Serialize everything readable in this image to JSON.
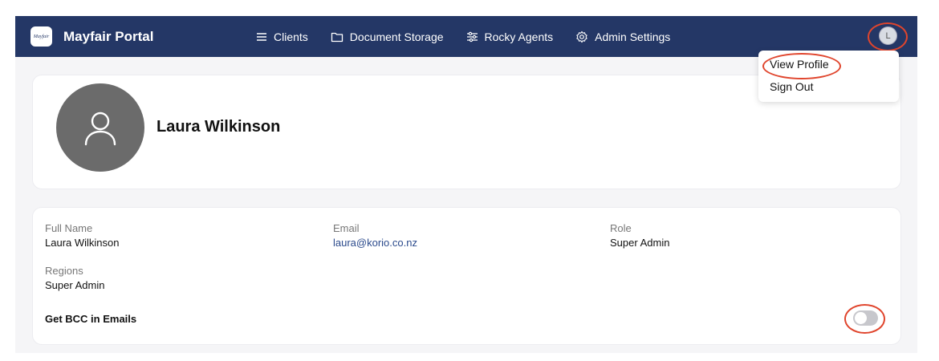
{
  "nav": {
    "brand_logo_text": "Mayfair",
    "brand_name": "Mayfair Portal",
    "items": [
      {
        "label": "Clients",
        "icon": "menu-icon"
      },
      {
        "label": "Document Storage",
        "icon": "folder-icon"
      },
      {
        "label": "Rocky Agents",
        "icon": "sliders-icon"
      },
      {
        "label": "Admin Settings",
        "icon": "gear-icon"
      }
    ],
    "avatar_initial": "L"
  },
  "dropdown": {
    "items": [
      {
        "label": "View Profile"
      },
      {
        "label": "Sign Out"
      }
    ]
  },
  "profile": {
    "name": "Laura Wilkinson"
  },
  "details": {
    "full_name_label": "Full Name",
    "full_name": "Laura Wilkinson",
    "email_label": "Email",
    "email": "laura@korio.co.nz",
    "role_label": "Role",
    "role": "Super Admin",
    "regions_label": "Regions",
    "regions": "Super Admin",
    "bcc_label": "Get BCC in Emails",
    "bcc_enabled": false
  },
  "colors": {
    "nav_bg": "#243766",
    "annotation": "#e0452d",
    "link": "#2b4a8c"
  }
}
